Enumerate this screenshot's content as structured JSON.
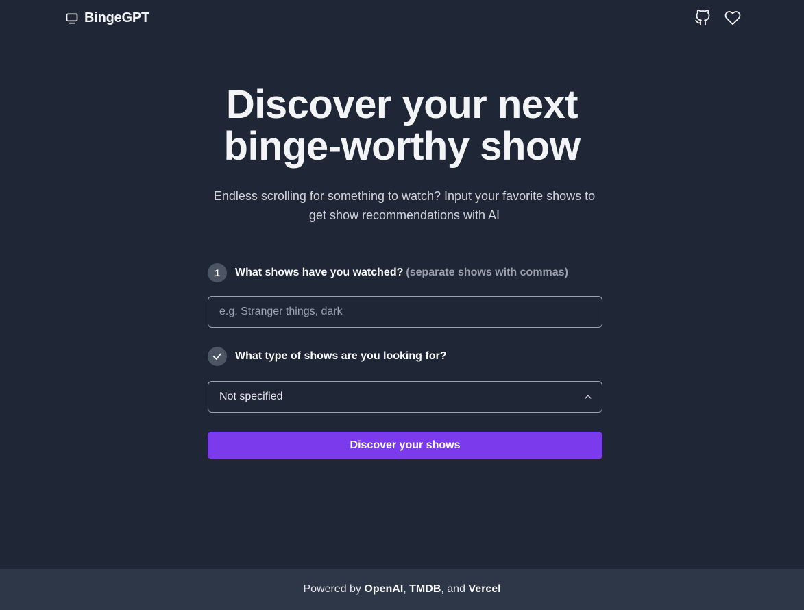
{
  "header": {
    "brand": "BingeGPT",
    "brand_icon": "tv-icon",
    "actions": [
      {
        "icon": "github-icon"
      },
      {
        "icon": "heart-icon"
      }
    ]
  },
  "hero": {
    "title_line1": "Discover your next",
    "title_line2": "binge-worthy show",
    "subtitle": "Endless scrolling for something to watch? Input your favorite shows to get show recommendations with AI"
  },
  "form": {
    "step1": {
      "badge": "1",
      "label": "What shows have you watched?",
      "hint": "(separate shows with commas)",
      "input_placeholder": "e.g. Stranger things, dark",
      "input_value": ""
    },
    "step2": {
      "badge_icon": "check-icon",
      "label": "What type of shows are you looking for?",
      "selected": "Not specified",
      "chevron_icon": "chevron-up-icon"
    },
    "submit_label": "Discover your shows"
  },
  "footer": {
    "prefix": "Powered by ",
    "links": [
      "OpenAI",
      "TMDB",
      "Vercel"
    ],
    "sep1": ", ",
    "sep2": ", and "
  },
  "colors": {
    "background": "#1f2737",
    "footer_bg": "#2e3748",
    "accent": "#7c3aed",
    "badge_bg": "#4b5563"
  }
}
